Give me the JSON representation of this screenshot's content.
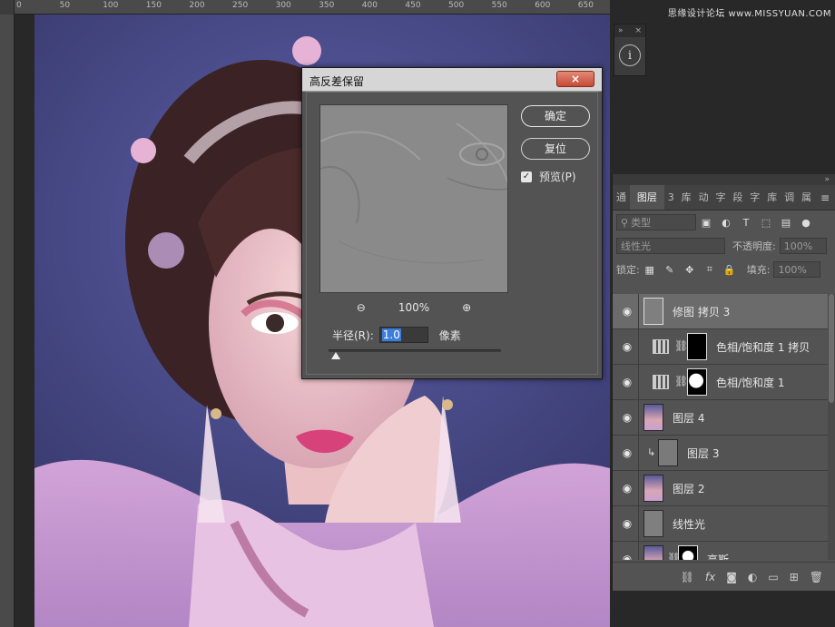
{
  "ruler": {
    "labels": [
      "0",
      "50",
      "100",
      "150",
      "200",
      "250",
      "300",
      "350",
      "400",
      "450",
      "500",
      "550",
      "600",
      "650"
    ]
  },
  "watermark": "思缘设计论坛 www.MISSYUAN.COM",
  "info_panel": {
    "icon": "info-icon",
    "glyph": "i",
    "collapse_glyph": "»",
    "close_glyph": "×"
  },
  "dialog": {
    "title": "高反差保留",
    "close_glyph": "×",
    "ok_label": "确定",
    "reset_label": "复位",
    "preview_label": "预览(P)",
    "preview_checked": true,
    "zoom_level": "100%",
    "radius_label": "半径(R):",
    "radius_value": "1.0",
    "radius_unit": "像素"
  },
  "layers_panel": {
    "tabs": [
      "通",
      "图层",
      "3",
      "库",
      "动",
      "字",
      "段",
      "字",
      "库",
      "调",
      "属"
    ],
    "active_tab": "图层",
    "filter_label": "类型",
    "blend_mode": "线性光",
    "opacity_label": "不透明度:",
    "opacity_value": "100%",
    "lock_label": "锁定:",
    "fill_label": "填充:",
    "fill_value": "100%",
    "layers": [
      {
        "name": "修图 拷贝 3",
        "kind": "gray",
        "selected": true
      },
      {
        "name": "色相/饱和度 1 拷贝",
        "kind": "adjustment",
        "selected": false
      },
      {
        "name": "色相/饱和度 1",
        "kind": "adjustment",
        "selected": false
      },
      {
        "name": "图层 4",
        "kind": "photo",
        "selected": false
      },
      {
        "name": "图层 3",
        "kind": "clipped",
        "selected": false
      },
      {
        "name": "图层 2",
        "kind": "photo",
        "selected": false
      },
      {
        "name": "线性光",
        "kind": "gray",
        "selected": false
      },
      {
        "name": "高斯",
        "kind": "photo-mask",
        "selected": false
      }
    ]
  },
  "colors": {
    "panel": "#535353",
    "dialog_title": "#d6d6d6",
    "close": "#c44b36",
    "selected_layer": "#6b6b6b",
    "highlight": "#3b7ddd"
  }
}
